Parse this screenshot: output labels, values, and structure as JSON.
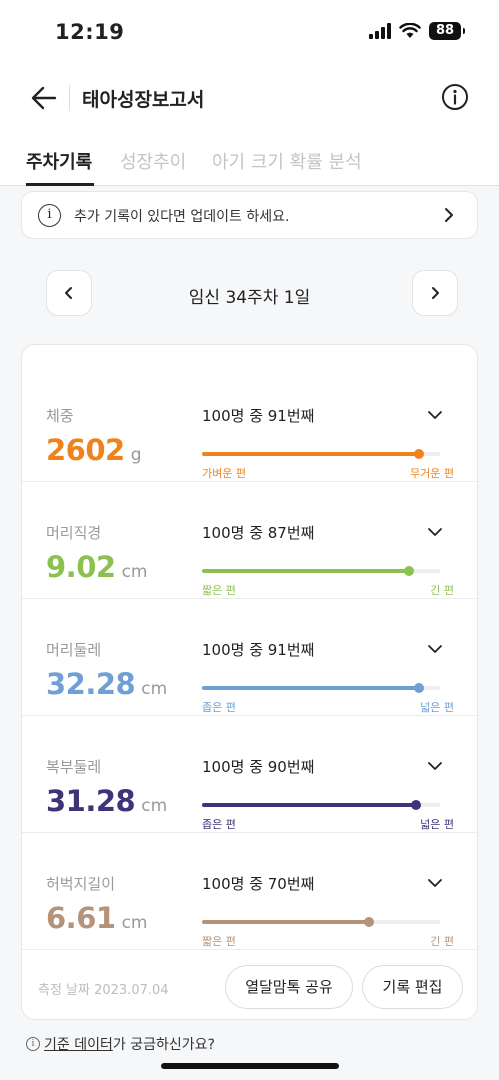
{
  "status_bar": {
    "time": "12:19",
    "battery": "88"
  },
  "header": {
    "title": "태아성장보고서"
  },
  "tabs": [
    {
      "label": "주차기록",
      "active": true
    },
    {
      "label": "성장추이",
      "active": false
    },
    {
      "label": "아기 크기 확률 분석",
      "active": false
    }
  ],
  "notice": {
    "text": "추가 기록이 있다면 업데이트 하세요."
  },
  "week": {
    "label": "임신 34주차 1일"
  },
  "metrics": [
    {
      "label": "체중",
      "value": "2602",
      "unit": "g",
      "rank": "100명 중 91번째",
      "percentile": 91,
      "left": "가벼운 편",
      "right": "무거운 편",
      "color": "#f0821e"
    },
    {
      "label": "머리직경",
      "value": "9.02",
      "unit": "cm",
      "rank": "100명 중 87번째",
      "percentile": 87,
      "left": "짧은 편",
      "right": "긴 편",
      "color": "#8cc152"
    },
    {
      "label": "머리둘레",
      "value": "32.28",
      "unit": "cm",
      "rank": "100명 중 91번째",
      "percentile": 91,
      "left": "좁은 편",
      "right": "넓은 편",
      "color": "#6f9fd4"
    },
    {
      "label": "복부둘레",
      "value": "31.28",
      "unit": "cm",
      "rank": "100명 중 90번째",
      "percentile": 90,
      "left": "좁은 편",
      "right": "넓은 편",
      "color": "#3e3578"
    },
    {
      "label": "허벅지길이",
      "value": "6.61",
      "unit": "cm",
      "rank": "100명 중 70번째",
      "percentile": 70,
      "left": "짧은 편",
      "right": "긴 편",
      "color": "#b5927a"
    }
  ],
  "footer": {
    "date": "측정 날짜 2023.07.04",
    "share_button": "열달맘톡 공유",
    "edit_button": "기록 편집"
  },
  "reference": {
    "link": "기준 데이터",
    "rest": "가 궁금하신가요?"
  }
}
